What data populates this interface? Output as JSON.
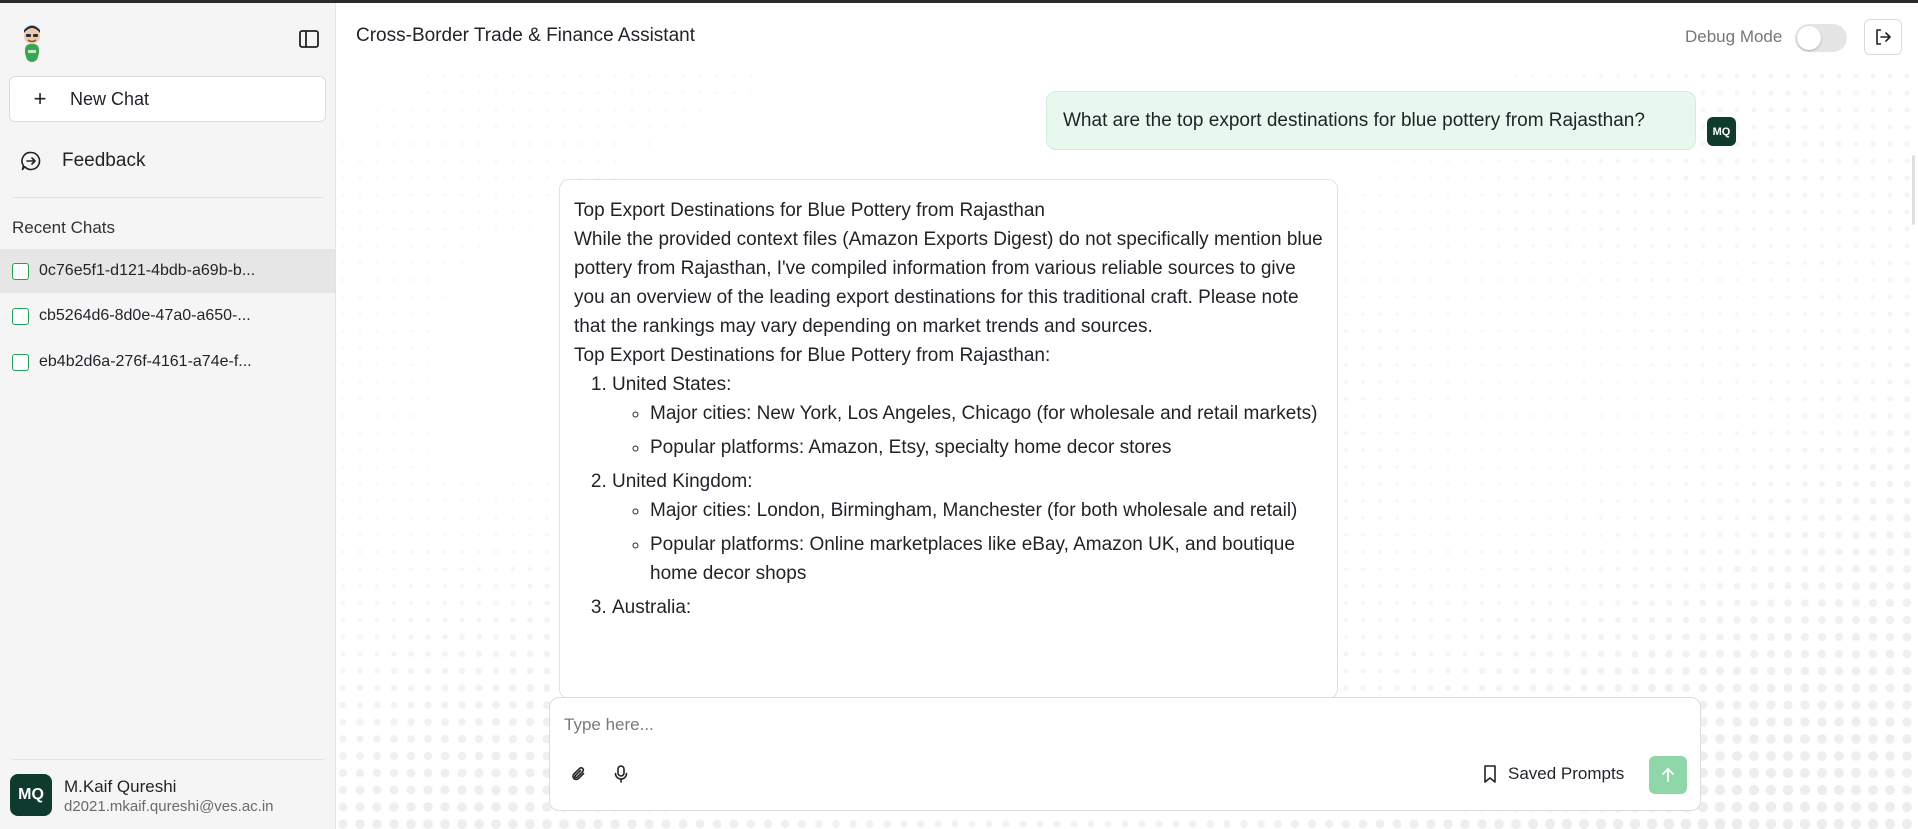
{
  "app": {
    "title": "Cross-Border Trade & Finance Assistant"
  },
  "header": {
    "debug_label": "Debug Mode",
    "debug_enabled": false
  },
  "sidebar": {
    "new_chat_label": "New Chat",
    "feedback_label": "Feedback",
    "recent_chats_title": "Recent Chats",
    "recent_chats": [
      {
        "label": "0c76e5f1-d121-4bdb-a69b-b...",
        "active": true
      },
      {
        "label": "cb5264d6-8d0e-47a0-a650-...",
        "active": false
      },
      {
        "label": "eb4b2d6a-276f-4161-a74e-f...",
        "active": false
      }
    ],
    "user": {
      "initials": "MQ",
      "name": "M.Kaif Qureshi",
      "email": "d2021.mkaif.qureshi@ves.ac.in"
    }
  },
  "conversation": {
    "user_message": "What are the top export destinations for blue pottery from Rajasthan?",
    "user_initials": "MQ",
    "assistant": {
      "heading": "Top Export Destinations for Blue Pottery from Rajasthan",
      "intro": "While the provided context files (Amazon Exports Digest) do not specifically mention blue pottery from Rajasthan, I've compiled information from various reliable sources to give you an overview of the leading export destinations for this traditional craft. Please note that the rankings may vary depending on market trends and sources.",
      "subheading": "Top Export Destinations for Blue Pottery from Rajasthan:",
      "destinations": [
        {
          "name": "United States:",
          "points": [
            "Major cities: New York, Los Angeles, Chicago (for wholesale and retail markets)",
            "Popular platforms: Amazon, Etsy, specialty home decor stores"
          ]
        },
        {
          "name": "United Kingdom:",
          "points": [
            "Major cities: London, Birmingham, Manchester (for both wholesale and retail)",
            "Popular platforms: Online marketplaces like eBay, Amazon UK, and boutique home decor shops"
          ]
        },
        {
          "name": "Australia:",
          "points": []
        }
      ]
    }
  },
  "composer": {
    "placeholder": "Type here...",
    "saved_prompts_label": "Saved Prompts"
  },
  "colors": {
    "accent_green": "#22a05a",
    "user_bubble": "#e8f8ef",
    "avatar_dark": "#0e3b2e",
    "send_button": "#8fd6a8"
  },
  "icons": {
    "logo": "assistant-avatar-logo",
    "sidebar_toggle": "sidebar-toggle-icon",
    "new_chat": "plus-icon",
    "feedback": "feedback-icon",
    "logout": "logout-icon",
    "attach": "paperclip-icon",
    "mic": "microphone-icon",
    "saved_prompts": "bookmark-icon",
    "send": "arrow-up-icon"
  }
}
